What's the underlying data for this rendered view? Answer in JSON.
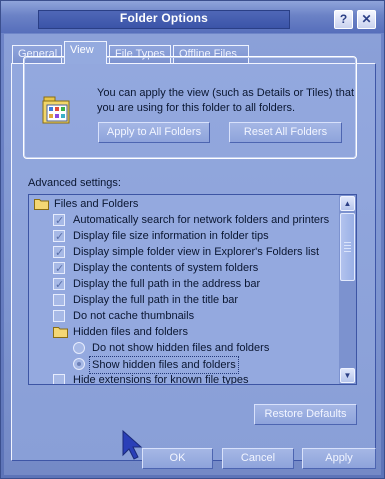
{
  "window": {
    "title": "Folder Options"
  },
  "titlebar": {
    "help_glyph": "?",
    "close_glyph": "✕"
  },
  "tabs": [
    {
      "label": "General"
    },
    {
      "label": "View"
    },
    {
      "label": "File Types"
    },
    {
      "label": "Offline Files"
    }
  ],
  "folder_views": {
    "description": "You can apply the view (such as Details or Tiles) that you are using for this folder to all folders.",
    "apply_all_label": "Apply to All Folders",
    "reset_all_label": "Reset All Folders"
  },
  "advanced": {
    "label": "Advanced settings:",
    "items": [
      {
        "kind": "folder",
        "label": "Files and Folders"
      },
      {
        "kind": "checkbox",
        "checked": true,
        "label": "Automatically search for network folders and printers"
      },
      {
        "kind": "checkbox",
        "checked": true,
        "label": "Display file size information in folder tips"
      },
      {
        "kind": "checkbox",
        "checked": true,
        "label": "Display simple folder view in Explorer's Folders list"
      },
      {
        "kind": "checkbox",
        "checked": true,
        "label": "Display the contents of system folders"
      },
      {
        "kind": "checkbox",
        "checked": true,
        "label": "Display the full path in the address bar"
      },
      {
        "kind": "checkbox",
        "checked": false,
        "label": "Display the full path in the title bar"
      },
      {
        "kind": "checkbox",
        "checked": false,
        "label": "Do not cache thumbnails"
      },
      {
        "kind": "folder",
        "label": "Hidden files and folders"
      },
      {
        "kind": "radio",
        "selected": false,
        "label": "Do not show hidden files and folders"
      },
      {
        "kind": "radio",
        "selected": true,
        "label": "Show hidden files and folders"
      },
      {
        "kind": "checkbox",
        "checked": false,
        "label": "Hide extensions for known file types"
      }
    ],
    "check_glyph": "✓",
    "scroll_up_glyph": "▲",
    "scroll_down_glyph": "▼"
  },
  "buttons": {
    "restore_defaults": "Restore Defaults",
    "ok": "OK",
    "cancel": "Cancel",
    "apply": "Apply"
  },
  "icons": {
    "folder_views": "folder-views-icon",
    "folder": "folder-icon",
    "cursor": "mouse-pointer-icon"
  },
  "colors": {
    "title_band": "#3b54a8",
    "dialog_body": "#8ba0d8",
    "text": "#0a1631"
  }
}
